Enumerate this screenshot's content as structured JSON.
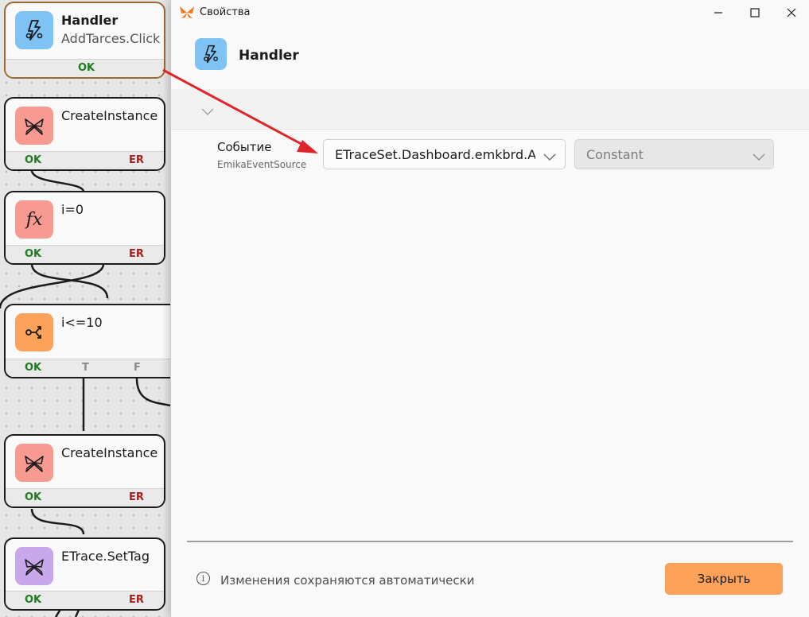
{
  "canvas": {
    "nodes": [
      {
        "title": "Handler",
        "subtitle": "AddTarces.Click",
        "icon": "lightning-handler-icon",
        "icon_color": "#7fc2f4",
        "ports": [
          "OK"
        ],
        "selected": true
      },
      {
        "title": "CreateInstance",
        "icon": "butterfly-icon",
        "icon_color": "#f79a92",
        "ports": [
          "OK",
          "ER"
        ]
      },
      {
        "title": "i=0",
        "icon": "function-icon",
        "icon_color": "#f79a92",
        "ports": [
          "OK",
          "ER"
        ]
      },
      {
        "title": "i<=10",
        "icon": "branch-icon",
        "icon_color": "#fca25a",
        "ports": [
          "OK",
          "T",
          "F"
        ]
      },
      {
        "title": "CreateInstance",
        "icon": "butterfly-icon",
        "icon_color": "#f79a92",
        "ports": [
          "OK",
          "ER"
        ]
      },
      {
        "title": "ETrace.SetTag",
        "icon": "butterfly-icon",
        "icon_color": "#c8a8ea",
        "ports": [
          "OK",
          "ER"
        ]
      }
    ]
  },
  "dialog": {
    "window_title": "Свойства",
    "app_icon": "butterfly-logo-icon",
    "accent_color": "#f07b22",
    "header": {
      "title": "Handler",
      "icon": "lightning-handler-icon"
    },
    "property": {
      "label": "Событие",
      "sublabel": "EmikaEventSource",
      "value": "ETraceSet.Dashboard.emkbrd.AddTarces.Click",
      "mode": "Constant"
    },
    "footer": {
      "note": "Изменения сохраняются автоматически",
      "close_label": "Закрыть",
      "close_color": "#fca25a"
    }
  }
}
